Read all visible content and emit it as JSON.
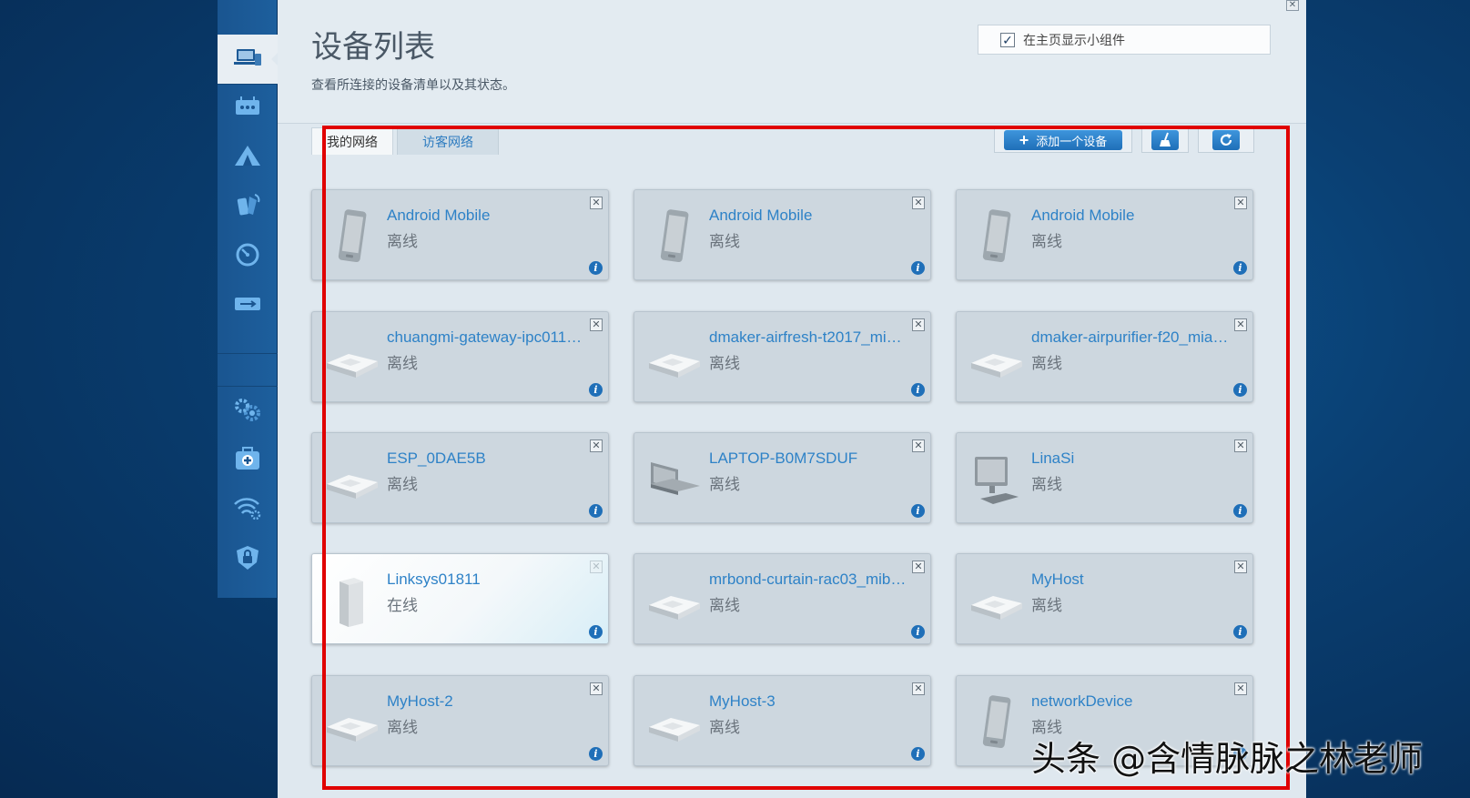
{
  "page": {
    "title": "设备列表",
    "subtitle": "查看所连接的设备清单以及其状态。",
    "widget_toggle": {
      "label": "在主页显示小组件",
      "checked": true
    },
    "close_glyph": "✕"
  },
  "sidebar": {
    "items": [
      {
        "icon": "devices-icon",
        "active": true
      },
      {
        "icon": "router-icon"
      },
      {
        "icon": "tent-icon"
      },
      {
        "icon": "parental-control-icon"
      },
      {
        "icon": "speedometer-icon"
      },
      {
        "icon": "usb-storage-icon"
      },
      {
        "icon": "gears-icon"
      },
      {
        "icon": "first-aid-icon"
      },
      {
        "icon": "wifi-settings-icon"
      },
      {
        "icon": "security-shield-icon"
      }
    ]
  },
  "tabs": {
    "my_network": "我的网络",
    "guest_network": "访客网络"
  },
  "toolbar": {
    "add_device": "添加一个设备",
    "broom_icon": "broom-icon",
    "refresh_icon": "refresh-icon"
  },
  "devices": [
    {
      "name": "Android Mobile",
      "status": "离线",
      "type": "phone"
    },
    {
      "name": "Android Mobile",
      "status": "离线",
      "type": "phone"
    },
    {
      "name": "Android Mobile",
      "status": "离线",
      "type": "phone"
    },
    {
      "name": "chuangmi-gateway-ipc011…",
      "status": "离线",
      "type": "generic"
    },
    {
      "name": "dmaker-airfresh-t2017_mi…",
      "status": "离线",
      "type": "generic"
    },
    {
      "name": "dmaker-airpurifier-f20_mia…",
      "status": "离线",
      "type": "generic"
    },
    {
      "name": "ESP_0DAE5B",
      "status": "离线",
      "type": "generic"
    },
    {
      "name": "LAPTOP-B0M7SDUF",
      "status": "离线",
      "type": "laptop"
    },
    {
      "name": "LinaSi",
      "status": "离线",
      "type": "desktop"
    },
    {
      "name": "Linksys01811",
      "status": "在线",
      "type": "router",
      "online": true
    },
    {
      "name": "mrbond-curtain-rac03_mib…",
      "status": "离线",
      "type": "generic"
    },
    {
      "name": "MyHost",
      "status": "离线",
      "type": "generic"
    },
    {
      "name": "MyHost-2",
      "status": "离线",
      "type": "generic"
    },
    {
      "name": "MyHost-3",
      "status": "离线",
      "type": "generic"
    },
    {
      "name": "networkDevice",
      "status": "离线",
      "type": "phone"
    }
  ],
  "card_glyphs": {
    "close": "✕",
    "info": "i"
  },
  "watermark": "头条 @含情脉脉之林老师"
}
